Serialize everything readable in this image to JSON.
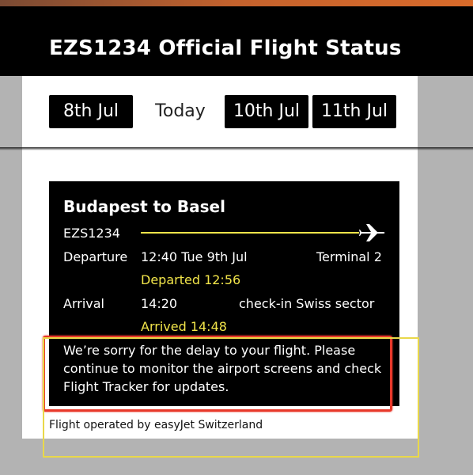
{
  "header": {
    "title": "EZS1234 Official Flight Status"
  },
  "dates": {
    "tabs": [
      {
        "label": "8th Jul"
      },
      {
        "label": "Today"
      },
      {
        "label": "10th Jul"
      },
      {
        "label": "11th Jul"
      }
    ]
  },
  "card": {
    "route": "Budapest to Basel",
    "flight_number": "EZS1234",
    "departure": {
      "label": "Departure",
      "time": "12:40 Tue 9th Jul",
      "terminal": "Terminal 2",
      "status": "Departed 12:56"
    },
    "arrival": {
      "label": "Arrival",
      "time": "14:20",
      "checkin": "check-in Swiss sector",
      "status": "Arrived 14:48"
    },
    "notice": "We’re sorry for the delay to your flight. Please continue to monitor the airport screens and check Flight Tracker for updates."
  },
  "footer": {
    "operated_by": "Flight operated by easyJet Switzerland"
  },
  "colors": {
    "accent_yellow": "#f2e54a",
    "highlight_red": "#e8382a",
    "highlight_yellow": "#e9d84a",
    "brand_orange": "#d96b2b"
  },
  "icons": {
    "plane": "airplane-icon"
  }
}
